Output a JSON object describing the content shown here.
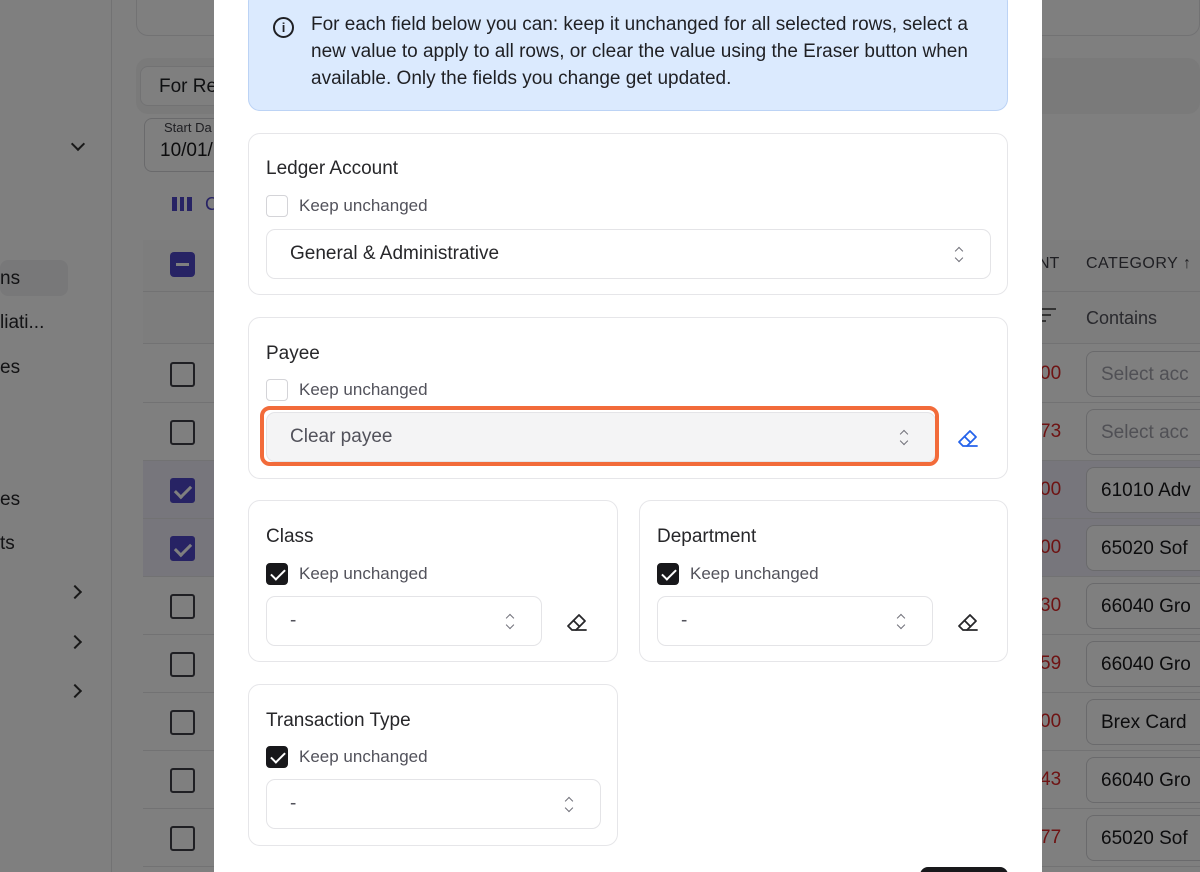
{
  "background": {
    "sidebar": {
      "items": [
        {
          "label": "ns"
        },
        {
          "label": "liati..."
        },
        {
          "label": "es"
        },
        {
          "label": "es"
        },
        {
          "label": "ts"
        }
      ]
    },
    "tab_label": "For Re",
    "start_date": {
      "label": "Start Da",
      "value": "10/01/"
    },
    "columns_button_label": "C",
    "table": {
      "headers": {
        "amount_partial": "NT",
        "category": "CATEGORY ↑"
      },
      "category_filter": "Contains",
      "rows": [
        {
          "checked": false,
          "amount": "00",
          "category": "Select acc",
          "placeholder": true
        },
        {
          "checked": false,
          "amount": "73",
          "category": "Select acc",
          "placeholder": true
        },
        {
          "checked": true,
          "amount": "00",
          "category": "61010 Adv",
          "placeholder": false
        },
        {
          "checked": true,
          "amount": "00",
          "category": "65020 Sof",
          "placeholder": false
        },
        {
          "checked": false,
          "amount": "30",
          "category": "66040 Gro",
          "placeholder": false
        },
        {
          "checked": false,
          "amount": "59",
          "category": "66040 Gro",
          "placeholder": false
        },
        {
          "checked": false,
          "amount": "00",
          "category": "Brex Card",
          "placeholder": false
        },
        {
          "checked": false,
          "amount": "43",
          "category": "66040 Gro",
          "placeholder": false
        },
        {
          "checked": false,
          "amount": "77",
          "category": "65020 Sof",
          "placeholder": false
        }
      ]
    }
  },
  "modal": {
    "info_text": "For each field below you can: keep it unchanged for all selected rows, select a new value to apply to all rows, or clear the value using the Eraser button when available. Only the fields you change get updated.",
    "keep_label": "Keep unchanged",
    "ledger": {
      "title": "Ledger Account",
      "keep_checked": false,
      "value": "General & Administrative"
    },
    "payee": {
      "title": "Payee",
      "keep_checked": false,
      "value": "Clear payee"
    },
    "class_field": {
      "title": "Class",
      "keep_checked": true,
      "value": "-"
    },
    "department": {
      "title": "Department",
      "keep_checked": true,
      "value": "-"
    },
    "transaction_type": {
      "title": "Transaction Type",
      "keep_checked": true,
      "value": "-"
    },
    "highlight_color": "#f26b3a",
    "eraser_active_color": "#2563eb"
  }
}
